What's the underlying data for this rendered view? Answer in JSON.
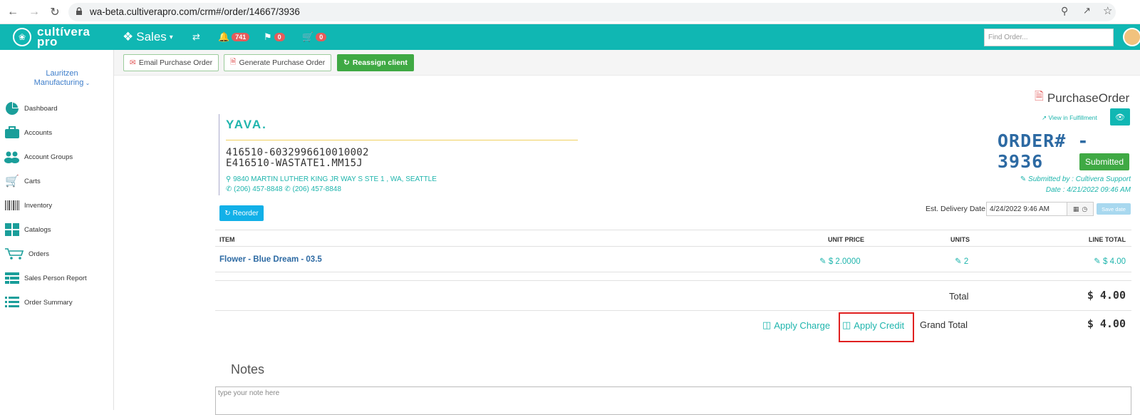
{
  "browser": {
    "url": "wa-beta.cultiverapro.com/crm#/order/14667/3936"
  },
  "header": {
    "brand_top": "cultívera",
    "brand_bottom": "pro",
    "sales_label": "Sales",
    "notifications_count": "741",
    "flags_count": "0",
    "cart_count": "0",
    "find_order_placeholder": "Find Order..."
  },
  "sidebar": {
    "company_line1": "Lauritzen",
    "company_line2": "Manufacturing",
    "items": [
      {
        "label": "Dashboard"
      },
      {
        "label": "Accounts"
      },
      {
        "label": "Account Groups"
      },
      {
        "label": "Carts"
      },
      {
        "label": "Inventory"
      },
      {
        "label": "Catalogs"
      },
      {
        "label": "Orders"
      },
      {
        "label": "Sales Person Report"
      },
      {
        "label": "Order Summary"
      }
    ]
  },
  "toolbar": {
    "email_po": "Email Purchase Order",
    "generate_po": "Generate Purchase Order",
    "reassign": "Reassign client"
  },
  "order": {
    "doc_title": "PurchaseOrder",
    "view_fulfillment": "View in Fulfillment",
    "order_number": "ORDER# - 3936",
    "status": "Submitted",
    "submitted_by": "Submitted by : Cultivera Support",
    "date": "Date : 4/21/2022 09:46 AM",
    "client_name": "YAVA.",
    "license1": "416510-6032996610010002",
    "license2": "E416510-WASTATE1.MM15J",
    "address": "9840 MARTIN LUTHER KING JR WAY S STE 1 , WA, SEATTLE",
    "phone1": "(206) 457-8848",
    "phone2": "(206) 457-8848",
    "reorder": "Reorder",
    "delivery_label": "Est. Delivery Date",
    "delivery_value": "4/24/2022 9:46 AM",
    "save_date": "Save date"
  },
  "table": {
    "headers": {
      "item": "ITEM",
      "unit_price": "UNIT PRICE",
      "units": "UNITS",
      "line_total": "LINE TOTAL"
    },
    "rows": [
      {
        "item": "Flower - Blue Dream - 03.5",
        "unit_price": "$ 2.0000",
        "units": "2",
        "line_total": "$ 4.00"
      }
    ],
    "total_label": "Total",
    "total_value": "$ 4.00",
    "apply_charge": "Apply Charge",
    "apply_credit": "Apply Credit",
    "grand_total_label": "Grand Total",
    "grand_total_value": "$ 4.00"
  },
  "notes": {
    "title": "Notes",
    "placeholder": "type your note here"
  }
}
